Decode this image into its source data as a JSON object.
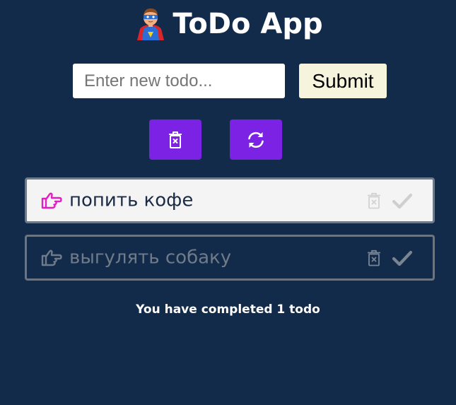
{
  "app": {
    "title": "ToDo App",
    "title_emoji": "superhero-man-emoji"
  },
  "form": {
    "input_placeholder": "Enter new todo...",
    "input_value": "",
    "submit_label": "Submit"
  },
  "toolbar": {
    "clear_icon": "trash-x-icon",
    "refresh_icon": "refresh-icon"
  },
  "todos": [
    {
      "text": "попить кофе",
      "completed": false,
      "icon": "hand-point-right-icon"
    },
    {
      "text": "выгулять собаку",
      "completed": true,
      "icon": "hand-point-right-icon"
    }
  ],
  "footer": {
    "status_text": "You have completed 1 todo"
  },
  "colors": {
    "background": "#132b4b",
    "accent": "#7c22e5",
    "submit_bg": "#f6f4dc",
    "active_todo_bg": "#f5f4f5",
    "active_hand": "#e11ec3",
    "muted": "#6f7b88"
  }
}
